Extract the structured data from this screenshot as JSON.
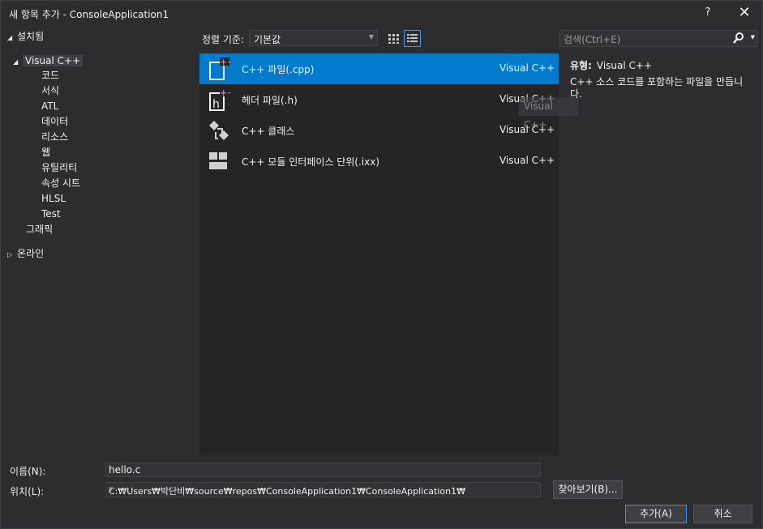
{
  "window": {
    "title": "새 항목 추가 - ConsoleApplication1",
    "help_label": "?",
    "close_label": "✕"
  },
  "tree": {
    "installed": "설치됨",
    "visual_cpp": "Visual C++",
    "children": [
      "코드",
      "서식",
      "ATL",
      "데이터",
      "리소스",
      "웹",
      "유틸리티",
      "속성 시트",
      "HLSL",
      "Test"
    ],
    "graphics": "그래픽",
    "online": "온라인"
  },
  "sort": {
    "label": "정렬 기준:",
    "value": "기본값"
  },
  "search": {
    "placeholder": "검색(Ctrl+E)"
  },
  "templates": [
    {
      "name": "C++ 파일(.cpp)",
      "lang": "Visual C++",
      "icon": "cpp-file-icon",
      "selected": true
    },
    {
      "name": "헤더 파일(.h)",
      "lang": "Visual C++",
      "icon": "header-file-icon",
      "selected": false
    },
    {
      "name": "C++ 클래스",
      "lang": "Visual C++",
      "icon": "class-icon",
      "selected": false
    },
    {
      "name": "C++ 모듈 인터페이스 단위(.ixx)",
      "lang": "Visual C++",
      "icon": "module-icon",
      "selected": false
    }
  ],
  "tooltip": "Visual C++",
  "details": {
    "type_label": "유형:",
    "type_value": "Visual C++",
    "description": "C++ 소스 코드를 포함하는 파일을 만듭니다."
  },
  "form": {
    "name_label": "이름(N):",
    "name_value": "hello.c",
    "location_label": "위치(L):",
    "location_value": "C:₩Users₩박단비₩source₩repos₩ConsoleApplication1₩ConsoleApplication1₩",
    "browse_label": "찾아보기(B)...",
    "add_label": "추가(A)",
    "cancel_label": "취소"
  },
  "colors": {
    "background": "#2d2d30",
    "panel": "#252526",
    "selection": "#007acc",
    "accent_border": "#3399ff",
    "icon_magenta": "#c586c0"
  }
}
